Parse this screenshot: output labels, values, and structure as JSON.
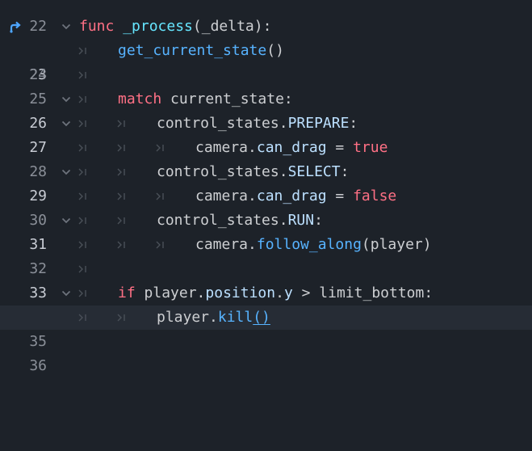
{
  "editor": {
    "lines": [
      {
        "num": "22"
      },
      {
        "num": "23",
        "tokens": [
          "func",
          " ",
          "_process",
          "(_delta):"
        ]
      },
      {
        "num": "24",
        "tokens": [
          "get_current_state",
          "()"
        ]
      },
      {
        "num": "25"
      },
      {
        "num": "26",
        "tokens": [
          "match",
          " current_state:"
        ]
      },
      {
        "num": "27",
        "tokens": [
          "control_states.",
          "PREPARE",
          ":"
        ]
      },
      {
        "num": "28",
        "tokens": [
          "camera.",
          "can_drag",
          " = ",
          "true"
        ]
      },
      {
        "num": "29",
        "tokens": [
          "control_states.",
          "SELECT",
          ":"
        ]
      },
      {
        "num": "30",
        "tokens": [
          "camera.",
          "can_drag",
          " = ",
          "false"
        ]
      },
      {
        "num": "31",
        "tokens": [
          "control_states.",
          "RUN",
          ":"
        ]
      },
      {
        "num": "32",
        "tokens": [
          "camera.",
          "follow_along",
          "(player)"
        ]
      },
      {
        "num": "33"
      },
      {
        "num": "34",
        "tokens": [
          "if",
          " player.",
          "position",
          ".",
          "y",
          " > limit_bottom:"
        ]
      },
      {
        "num": "35",
        "tokens": [
          "player.",
          "kill",
          "()"
        ]
      },
      {
        "num": "36"
      }
    ]
  },
  "icons": {
    "override_marker": "method-override-icon",
    "fold": "chevron-down-icon",
    "tab": "tab-indent-icon"
  },
  "colors": {
    "background": "#1d2229",
    "current_line": "#262c35",
    "keyword": "#ff7085",
    "function_call": "#57b3ff",
    "function_def": "#66e6ff",
    "member": "#bce0ff",
    "text": "#cdcfd2",
    "line_number": "#8a8f98",
    "marker": "#4ea6ff"
  }
}
